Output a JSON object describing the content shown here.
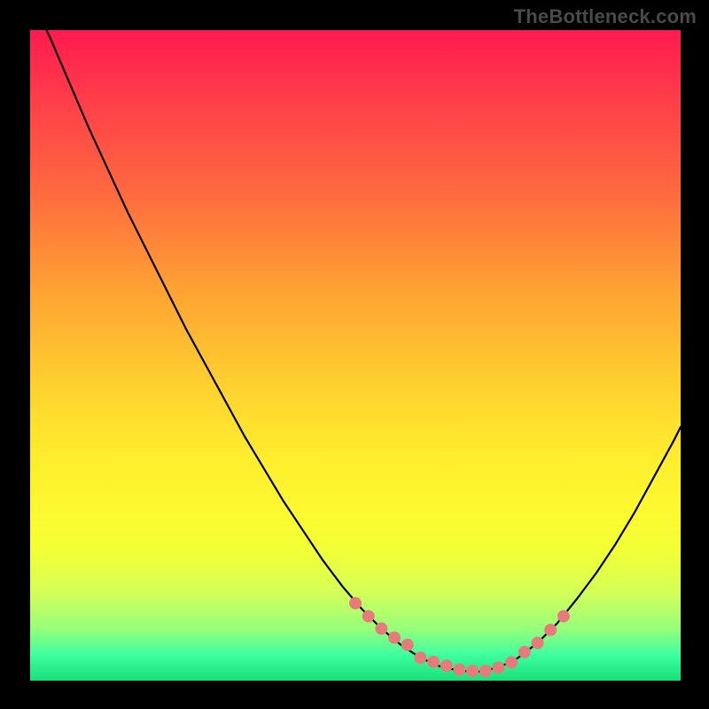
{
  "watermark": "TheBottleneck.com",
  "chart_data": {
    "type": "line",
    "title": "",
    "xlabel": "",
    "ylabel": "",
    "xlim": [
      0,
      100
    ],
    "ylim": [
      0,
      100
    ],
    "x": [
      0,
      3,
      6,
      9,
      12,
      15,
      18,
      21,
      24,
      27,
      30,
      33,
      36,
      39,
      42,
      45,
      48,
      51,
      54,
      57,
      60,
      63,
      66,
      69,
      72,
      75,
      78,
      81,
      84,
      87,
      90,
      93,
      96,
      99,
      100
    ],
    "values": [
      105,
      99,
      92,
      85,
      78.5,
      72,
      66,
      60,
      54,
      48.5,
      43,
      37.5,
      32.5,
      27.5,
      23,
      18.5,
      14.5,
      11,
      8,
      5.5,
      3.5,
      2.2,
      1.5,
      1.4,
      2,
      3.5,
      5.8,
      8.8,
      12.5,
      16.5,
      21,
      26,
      31.5,
      37,
      39
    ],
    "marker_points_x": [
      50,
      52,
      54,
      56,
      58,
      60,
      62,
      64,
      66,
      68,
      70,
      72,
      74,
      76,
      78,
      80,
      82
    ],
    "marker_points_y": [
      11.9,
      9.9,
      8.0,
      6.6,
      5.5,
      3.5,
      2.9,
      2.3,
      1.7,
      1.5,
      1.5,
      2.0,
      2.8,
      4.4,
      5.8,
      7.8,
      9.9
    ],
    "marker_color": "#e77b7b",
    "curve_color": "#000000"
  }
}
